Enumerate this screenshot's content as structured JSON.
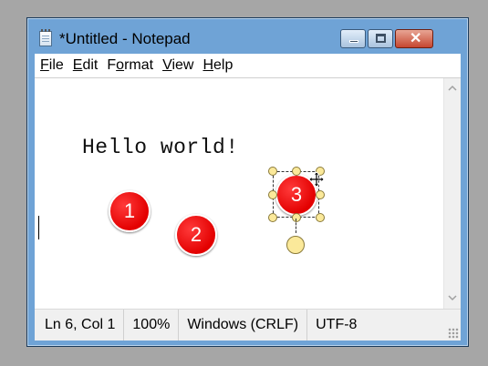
{
  "window": {
    "title": "*Untitled - Notepad",
    "close_symbol": "✕"
  },
  "menu": {
    "items": [
      {
        "key": "F",
        "rest": "ile"
      },
      {
        "key": "E",
        "rest": "dit"
      },
      {
        "pre": "F",
        "key": "o",
        "rest": "rmat"
      },
      {
        "key": "V",
        "rest": "iew"
      },
      {
        "key": "H",
        "rest": "elp"
      }
    ]
  },
  "editor": {
    "content_line": "Hello world!",
    "markers": [
      "1",
      "2",
      "3"
    ]
  },
  "status": {
    "position": "Ln 6, Col 1",
    "zoom": "100%",
    "line_ending": "Windows (CRLF)",
    "encoding": "UTF-8"
  },
  "icons": {
    "app": "notepad-icon",
    "minimize": "minimize-icon",
    "maximize": "maximize-icon",
    "close": "close-icon",
    "scroll_up": "chevron-up-icon",
    "scroll_down": "chevron-down-icon",
    "cursor": "move-cursor-icon"
  },
  "colors": {
    "marker": "#e30000",
    "handle": "#fbe99a",
    "frame": "#6fa3d6"
  }
}
